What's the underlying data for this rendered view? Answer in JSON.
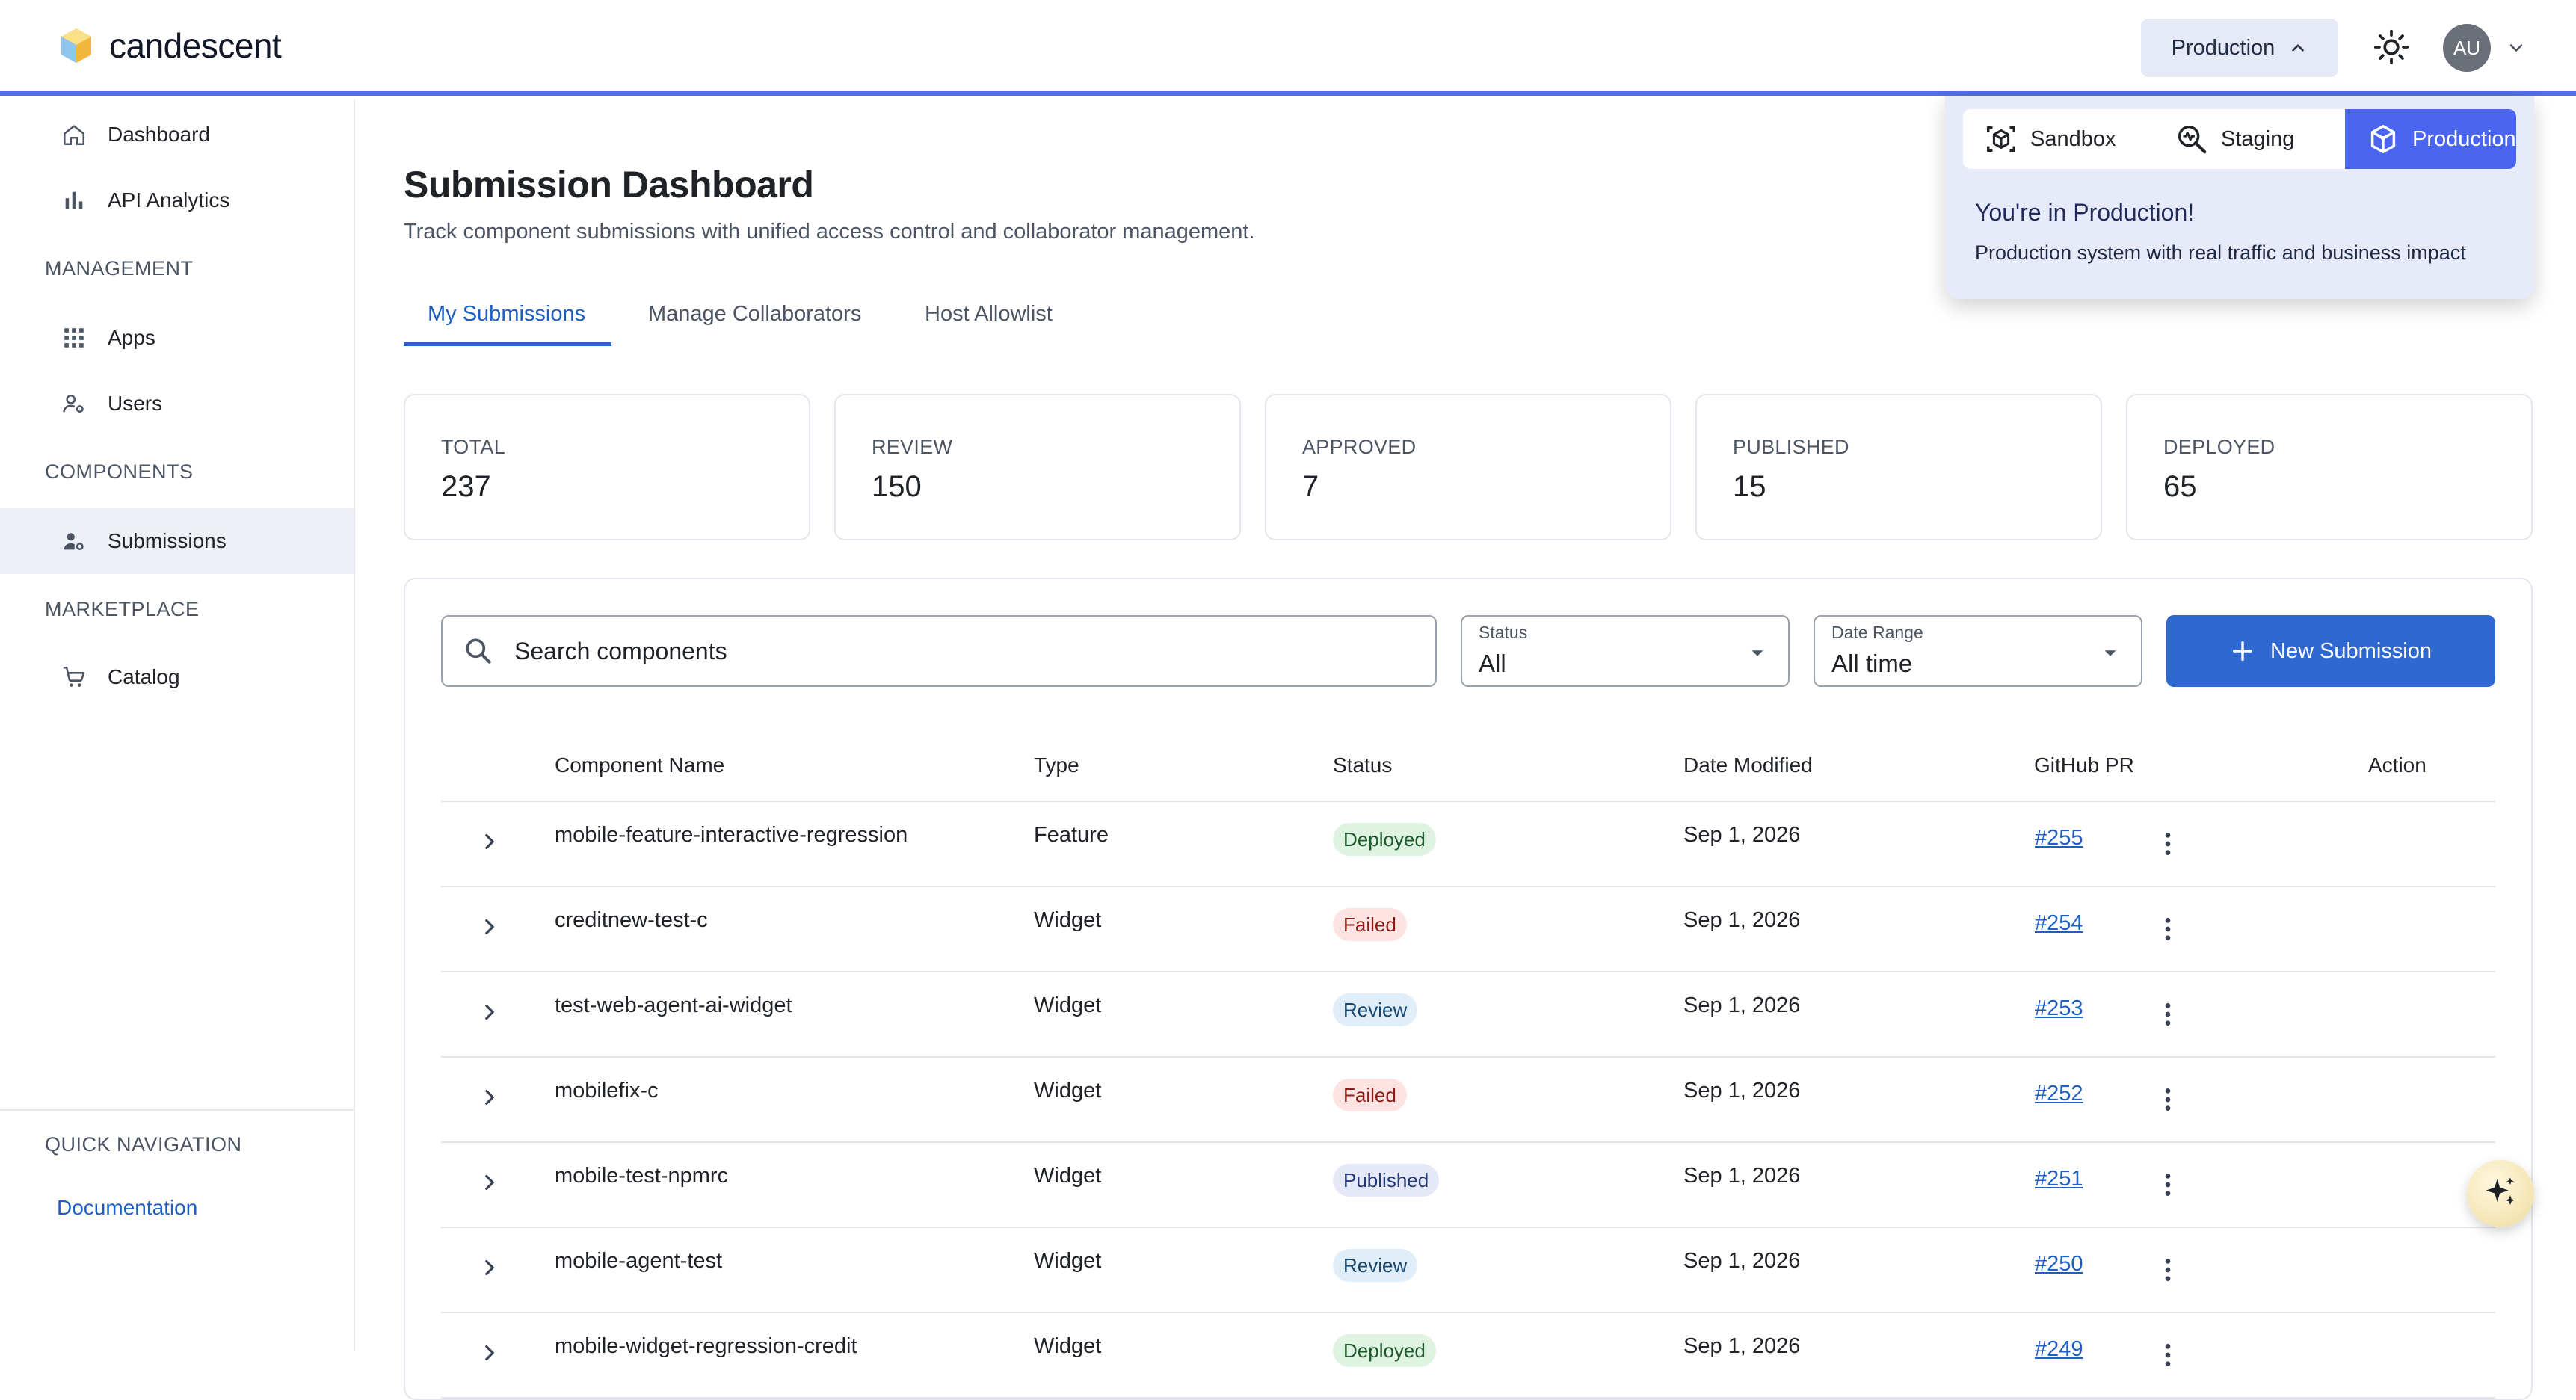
{
  "app": {
    "name": "candescent"
  },
  "header": {
    "env_button": "Production",
    "avatar_initials": "AU"
  },
  "sidebar": {
    "items": [
      {
        "label": "Dashboard"
      },
      {
        "label": "API Analytics"
      },
      {
        "label": "Apps"
      },
      {
        "label": "Users"
      },
      {
        "label": "Submissions"
      },
      {
        "label": "Catalog"
      }
    ],
    "sections": [
      "MANAGEMENT",
      "COMPONENTS",
      "MARKETPLACE"
    ],
    "quick_nav": {
      "title": "QUICK NAVIGATION",
      "link": "Documentation"
    }
  },
  "page": {
    "title": "Submission Dashboard",
    "subtitle": "Track component submissions with unified access control and collaborator management.",
    "tabs": [
      {
        "label": "My Submissions"
      },
      {
        "label": "Manage Collaborators"
      },
      {
        "label": "Host Allowlist"
      }
    ]
  },
  "stats": [
    {
      "label": "TOTAL",
      "value": "237"
    },
    {
      "label": "REVIEW",
      "value": "150"
    },
    {
      "label": "APPROVED",
      "value": "7"
    },
    {
      "label": "PUBLISHED",
      "value": "15"
    },
    {
      "label": "DEPLOYED",
      "value": "65"
    }
  ],
  "toolbar": {
    "search_placeholder": "Search components",
    "status": {
      "label": "Status",
      "value": "All"
    },
    "date_range": {
      "label": "Date Range",
      "value": "All time"
    },
    "new_button": "New Submission"
  },
  "table": {
    "headers": [
      "Component Name",
      "Type",
      "Status",
      "Date Modified",
      "GitHub PR",
      "Action"
    ],
    "rows": [
      {
        "name": "mobile-feature-interactive-regression",
        "type": "Feature",
        "status": "Deployed",
        "date": "Sep 1, 2026",
        "pr": "#255"
      },
      {
        "name": "creditnew-test-c",
        "type": "Widget",
        "status": "Failed",
        "date": "Sep 1, 2026",
        "pr": "#254"
      },
      {
        "name": "test-web-agent-ai-widget",
        "type": "Widget",
        "status": "Review",
        "date": "Sep 1, 2026",
        "pr": "#253"
      },
      {
        "name": "mobilefix-c",
        "type": "Widget",
        "status": "Failed",
        "date": "Sep 1, 2026",
        "pr": "#252"
      },
      {
        "name": "mobile-test-npmrc",
        "type": "Widget",
        "status": "Published",
        "date": "Sep 1, 2026",
        "pr": "#251"
      },
      {
        "name": "mobile-agent-test",
        "type": "Widget",
        "status": "Review",
        "date": "Sep 1, 2026",
        "pr": "#250"
      },
      {
        "name": "mobile-widget-regression-credit",
        "type": "Widget",
        "status": "Deployed",
        "date": "Sep 1, 2026",
        "pr": "#249"
      }
    ]
  },
  "env_popover": {
    "options": [
      {
        "label": "Sandbox",
        "icon": "sandbox-icon"
      },
      {
        "label": "Staging",
        "icon": "staging-icon"
      },
      {
        "label": "Production",
        "icon": "production-icon"
      }
    ],
    "selected": "Production",
    "title": "You're in Production!",
    "description": "Production system with real traffic and business impact"
  },
  "colors": {
    "accent": "#4f6df5",
    "primary_button": "#2f68d1",
    "link": "#1d5fc4"
  }
}
